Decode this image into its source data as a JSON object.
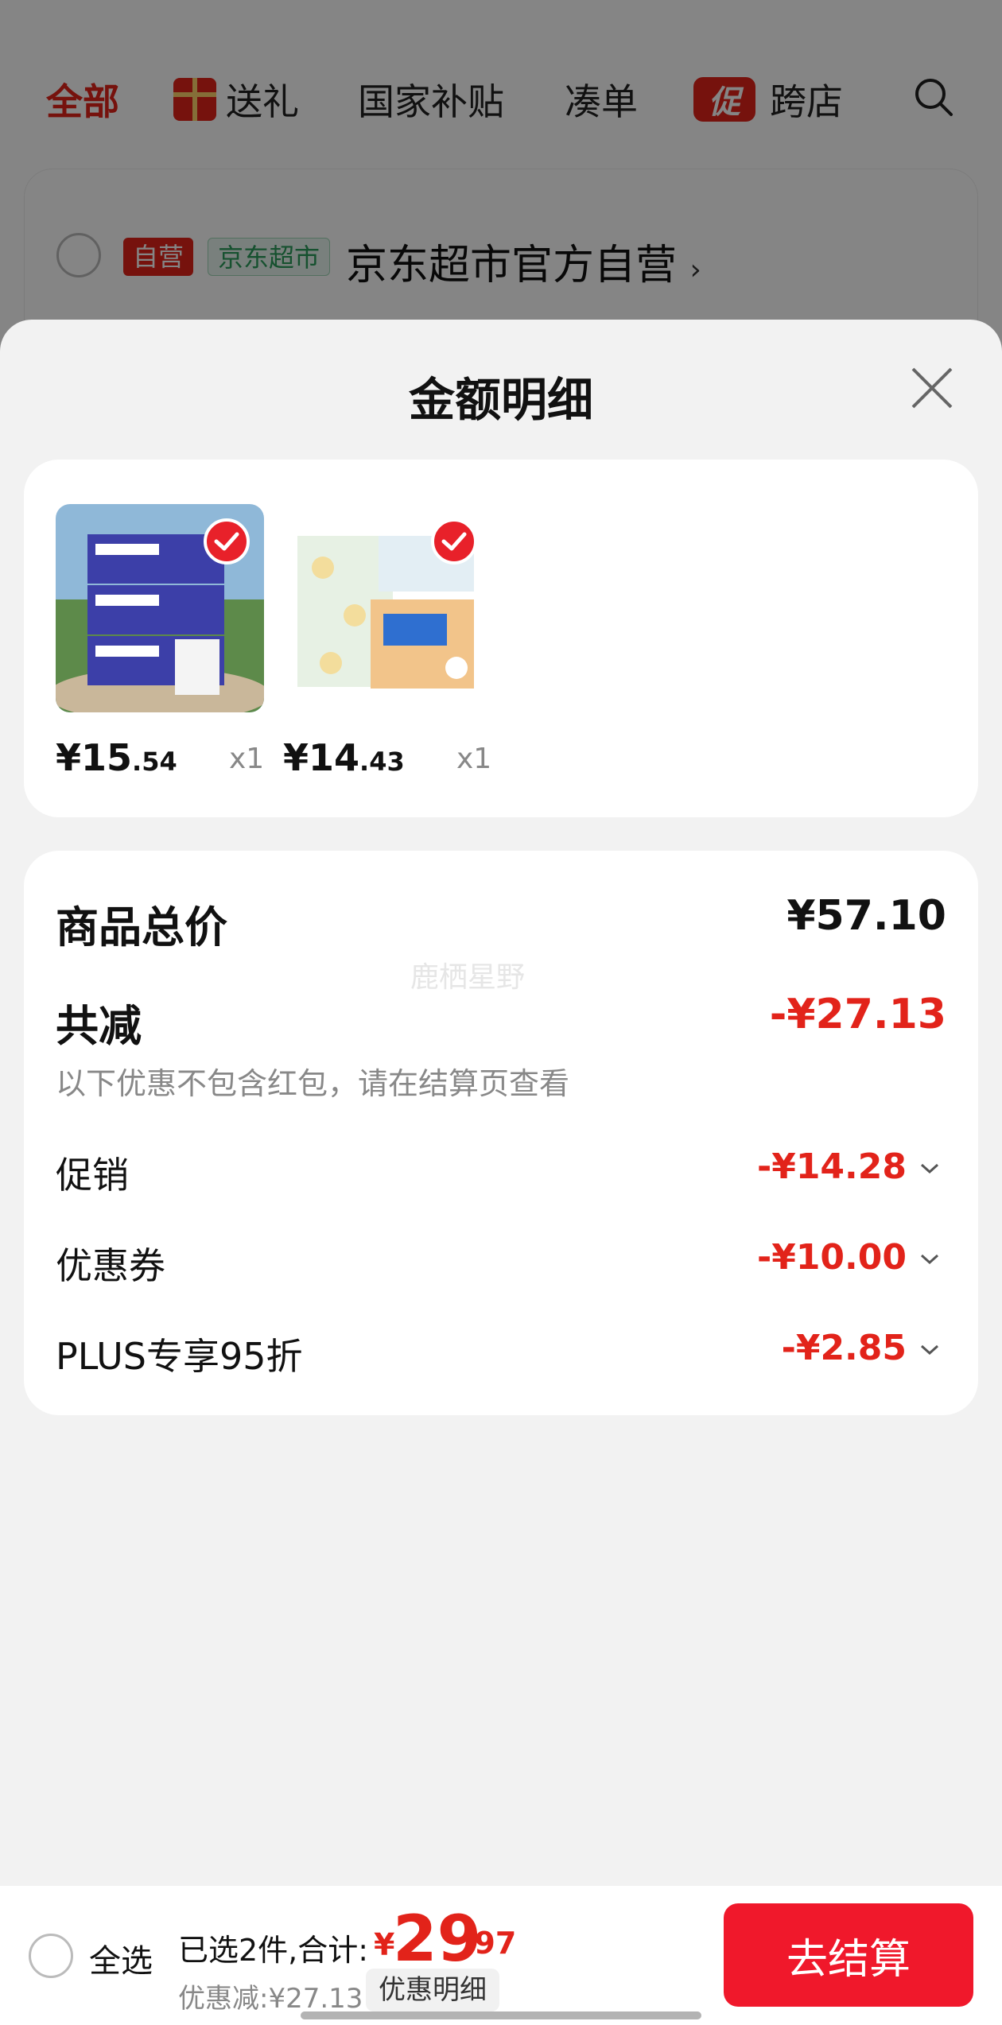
{
  "background": {
    "tabs": [
      {
        "label": "全部",
        "active": true
      },
      {
        "label": "送礼",
        "icon": "gift-icon"
      },
      {
        "label": "国家补贴"
      },
      {
        "label": "凑单"
      },
      {
        "label": "跨店",
        "badge": "促"
      }
    ],
    "store": {
      "self_badge": "自营",
      "market_badge": "京东超市",
      "name": "京东超市官方自营",
      "chevron": "›"
    }
  },
  "sheet": {
    "title": "金额明细",
    "goods": [
      {
        "price_int": "¥15",
        "price_dec": ".54",
        "qty": "x1",
        "checked": true,
        "image": "tissue-pack-blue"
      },
      {
        "price_int": "¥14",
        "price_dec": ".43",
        "qty": "x1",
        "checked": true,
        "image": "tissue-pack-orange"
      }
    ],
    "detail": {
      "total_label": "商品总价",
      "total_value": "¥57.10",
      "reduce_label": "共减",
      "reduce_value": "-¥27.13",
      "note": "以下优惠不包含红包，请在结算页查看",
      "items": [
        {
          "label": "促销",
          "value": "-¥14.28"
        },
        {
          "label": "优惠券",
          "value": "-¥10.00"
        },
        {
          "label": "PLUS专享95折",
          "value": "-¥2.85"
        }
      ]
    },
    "watermark": "鹿栖星野"
  },
  "bottom": {
    "select_all": "全选",
    "selected_text": "已选2件,合计:",
    "sum_yen": "¥",
    "sum_int": "29",
    "sum_dec": ".97",
    "saved_text": "优惠减:¥27.13",
    "detail_link": "优惠明细",
    "checkout": "去结算"
  },
  "colors": {
    "accent": "#e2231a",
    "checkout": "#f0182b",
    "sheet_bg": "#f2f2f2"
  }
}
